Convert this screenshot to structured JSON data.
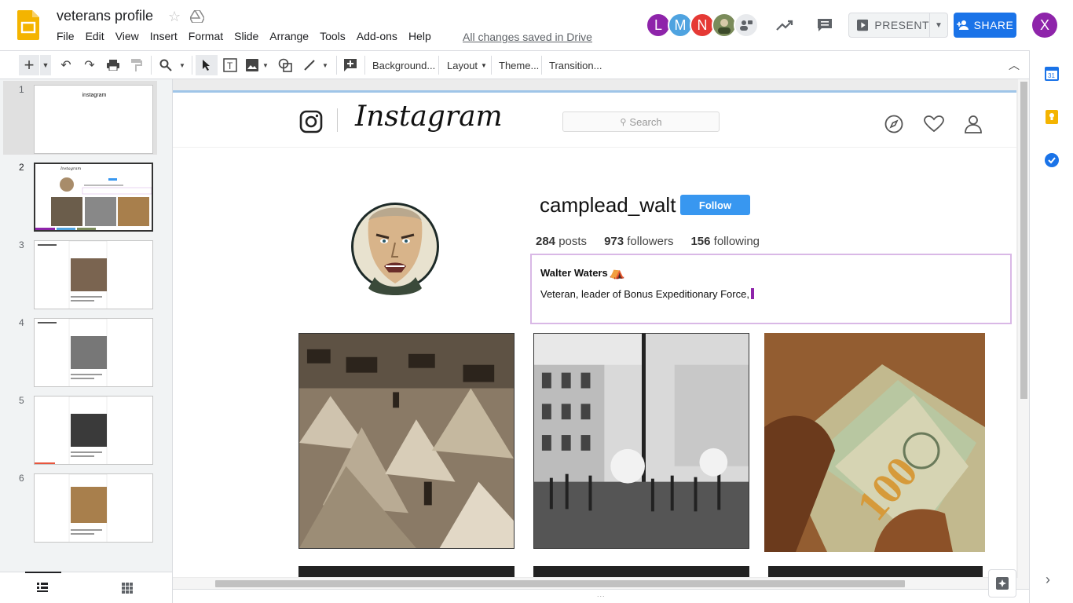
{
  "header": {
    "doc_title": "veterans profile",
    "save_status": "All changes saved in Drive",
    "menu": [
      "File",
      "Edit",
      "View",
      "Insert",
      "Format",
      "Slide",
      "Arrange",
      "Tools",
      "Add-ons",
      "Help"
    ],
    "collaborators": [
      {
        "initial": "L",
        "color": "#8e24aa"
      },
      {
        "initial": "M",
        "color": "#4fa3e0"
      },
      {
        "initial": "N",
        "color": "#e53935"
      }
    ],
    "present_label": "PRESENT",
    "share_label": "SHARE",
    "account_initial": "X",
    "account_color": "#8e24aa"
  },
  "toolbar": {
    "background_label": "Background...",
    "layout_label": "Layout",
    "theme_label": "Theme...",
    "transition_label": "Transition..."
  },
  "filmstrip": {
    "slides": [
      "1",
      "2",
      "3",
      "4",
      "5",
      "6"
    ],
    "selected": "2",
    "slide1_title": "instagram"
  },
  "slide": {
    "search_placeholder": "Search",
    "username": "camplead_walt",
    "follow_label": "Follow",
    "posts_count": "284",
    "posts_label": "posts",
    "followers_count": "973",
    "followers_label": "followers",
    "following_count": "156",
    "following_label": "following",
    "bio_name": "Walter Waters",
    "bio_name_emoji": "⛺",
    "bio_text": "Veteran, leader of Bonus Expeditionary Force,",
    "wordmark": "Instagram"
  },
  "colors": {
    "accent": "#1a73e8",
    "slides_yellow": "#f4b400",
    "follow_blue": "#3897f0",
    "bio_border": "#d9b8e6"
  }
}
